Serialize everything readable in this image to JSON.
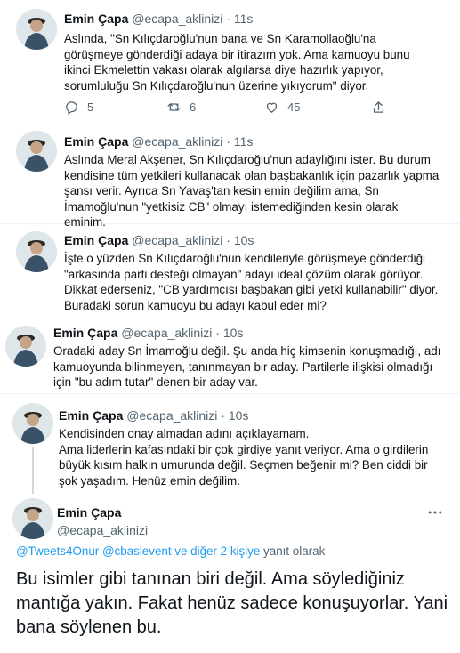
{
  "tweets": [
    {
      "name": "Emin Çapa",
      "handle": "@ecapa_aklinizi",
      "time": "11s",
      "text": "Aslında, \"Sn Kılıçdaroğlu'nun bana ve Sn Karamollaoğlu'na görüşmeye gönderdiği adaya bir itirazım yok. Ama kamuoyu bunu ikinci Ekmelettin vakası olarak algılarsa diye hazırlık yapıyor, sorumluluğu Sn Kılıçdaroğlu'nun üzerine yıkıyorum\" diyor.",
      "actions": {
        "replies": "5",
        "retweets": "6",
        "likes": "45"
      }
    },
    {
      "name": "Emin Çapa",
      "handle": "@ecapa_aklinizi",
      "time": "11s",
      "text": "Aslında Meral Akşener, Sn Kılıçdaroğlu'nun adaylığını ister. Bu durum kendisine tüm yetkileri kullanacak olan başbakanlık için pazarlık yapma şansı verir. Ayrıca Sn Yavaş'tan kesin emin değilim ama, Sn İmamoğlu'nun \"yetkisiz CB\" olmayı istemediğinden kesin olarak eminim."
    },
    {
      "name": "Emin Çapa",
      "handle": "@ecapa_aklinizi",
      "time": "10s",
      "text": "İşte o yüzden Sn Kılıçdaroğlu'nun kendileriyle görüşmeye gönderdiği \"arkasında parti desteği olmayan\" adayı ideal çözüm olarak görüyor. Dikkat ederseniz, \"CB yardımcısı başbakan gibi yetki kullanabilir\" diyor. Buradaki sorun kamuoyu bu adayı kabul eder mi?"
    },
    {
      "name": "Emin Çapa",
      "handle": "@ecapa_aklinizi",
      "time": "10s",
      "text": "Oradaki aday Sn İmamoğlu değil. Şu anda hiç kimsenin konuşmadığı, adı kamuoyunda bilinmeyen, tanınmayan bir aday. Partilerle ilişkisi olmadığı için \"bu adım tutar\" denen bir aday var."
    },
    {
      "name": "Emin Çapa",
      "handle": "@ecapa_aklinizi",
      "time": "10s",
      "text": "Kendisinden onay almadan adını açıklayamam.\nAma liderlerin kafasındaki bir çok girdiye yanıt veriyor. Ama o girdilerin büyük kısım halkın umurunda değil. Seçmen beğenir mi? Ben ciddi bir şok yaşadım. Henüz emin değilim."
    }
  ],
  "main_tweet": {
    "name": "Emin Çapa",
    "handle": "@ecapa_aklinizi",
    "reply_mentions": "@Tweets4Onur @cbaslevent",
    "reply_others": "ve diğer 2 kişiye",
    "reply_suffix": "yanıt olarak",
    "text": "Bu isimler gibi tanınan biri değil. Ama söylediğiniz mantığa yakın. Fakat henüz sadece konuşuyorlar. Yani bana söylenen bu."
  },
  "colors": {
    "accent": "#1d9bf0",
    "muted": "#536471",
    "text": "#0f1419",
    "thread": "#cfd9de"
  },
  "icons": [
    "reply-icon",
    "retweet-icon",
    "like-icon",
    "share-icon",
    "more-icon",
    "avatar-icon"
  ]
}
